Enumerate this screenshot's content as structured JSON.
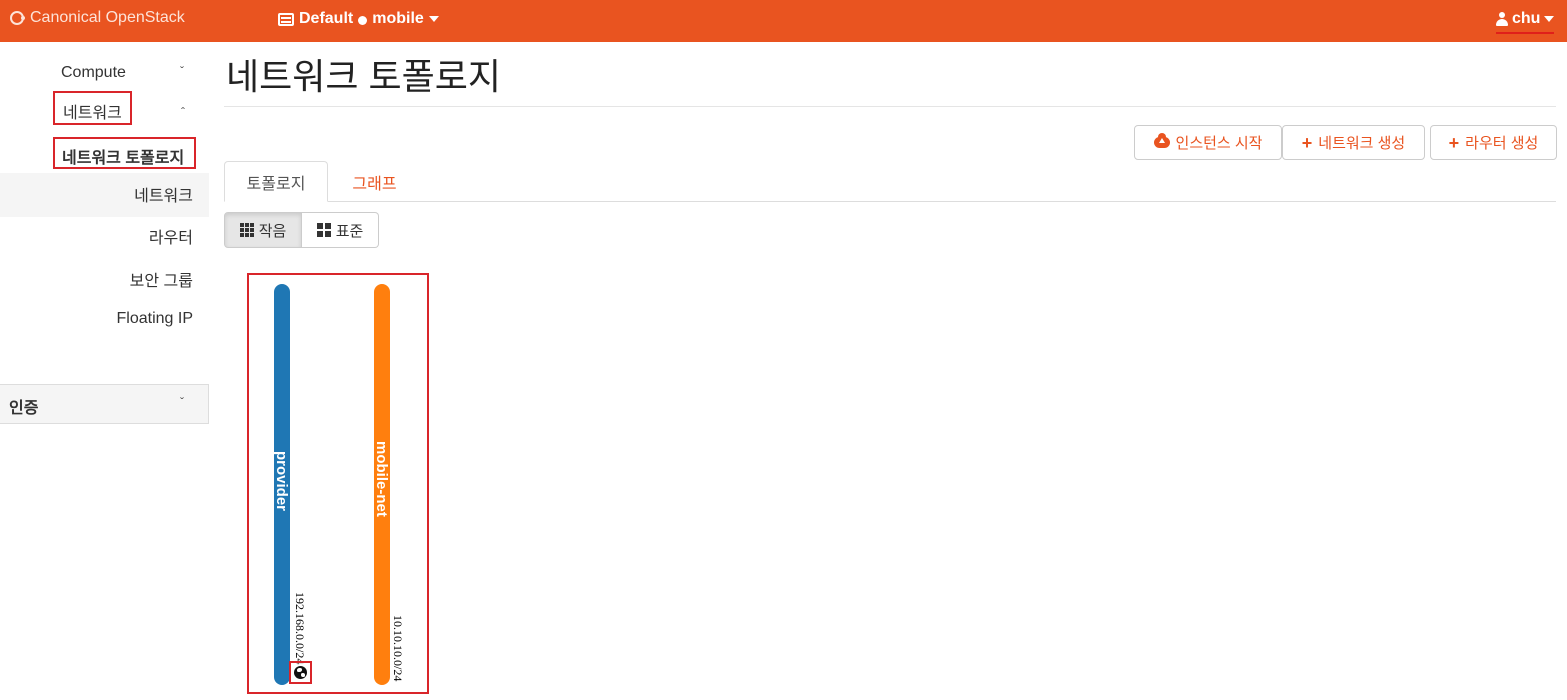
{
  "topbar": {
    "brand": "Canonical OpenStack",
    "domain": "Default",
    "project": "mobile",
    "user": "chu",
    "accent_color": "#e95420"
  },
  "sidebar": {
    "compute": "Compute",
    "network_group": "네트워크",
    "items": [
      {
        "label": "네트워크 토폴로지",
        "active": true
      },
      {
        "label": "네트워크"
      },
      {
        "label": "라우터"
      },
      {
        "label": "보안 그룹"
      },
      {
        "label": "Floating IP"
      }
    ],
    "auth": "인증",
    "chevrons": {
      "down": "ˇ",
      "up": "ˆ"
    }
  },
  "main": {
    "title": "네트워크 토폴로지",
    "actions": {
      "launch_instance": "인스턴스 시작",
      "create_network": "네트워크 생성",
      "create_router": "라우터 생성",
      "plus": "+"
    },
    "tabs": {
      "topology": "토폴로지",
      "graph": "그래프"
    },
    "view_toggle": {
      "small": "작음",
      "normal": "표준",
      "selected": "small"
    }
  },
  "topology": {
    "networks": [
      {
        "name": "provider",
        "cidr": "192.168.0.0/24",
        "color": "#1f77b4",
        "external": true
      },
      {
        "name": "mobile-net",
        "cidr": "10.10.10.0/24",
        "color": "#ff7f0e",
        "external": false
      }
    ]
  }
}
